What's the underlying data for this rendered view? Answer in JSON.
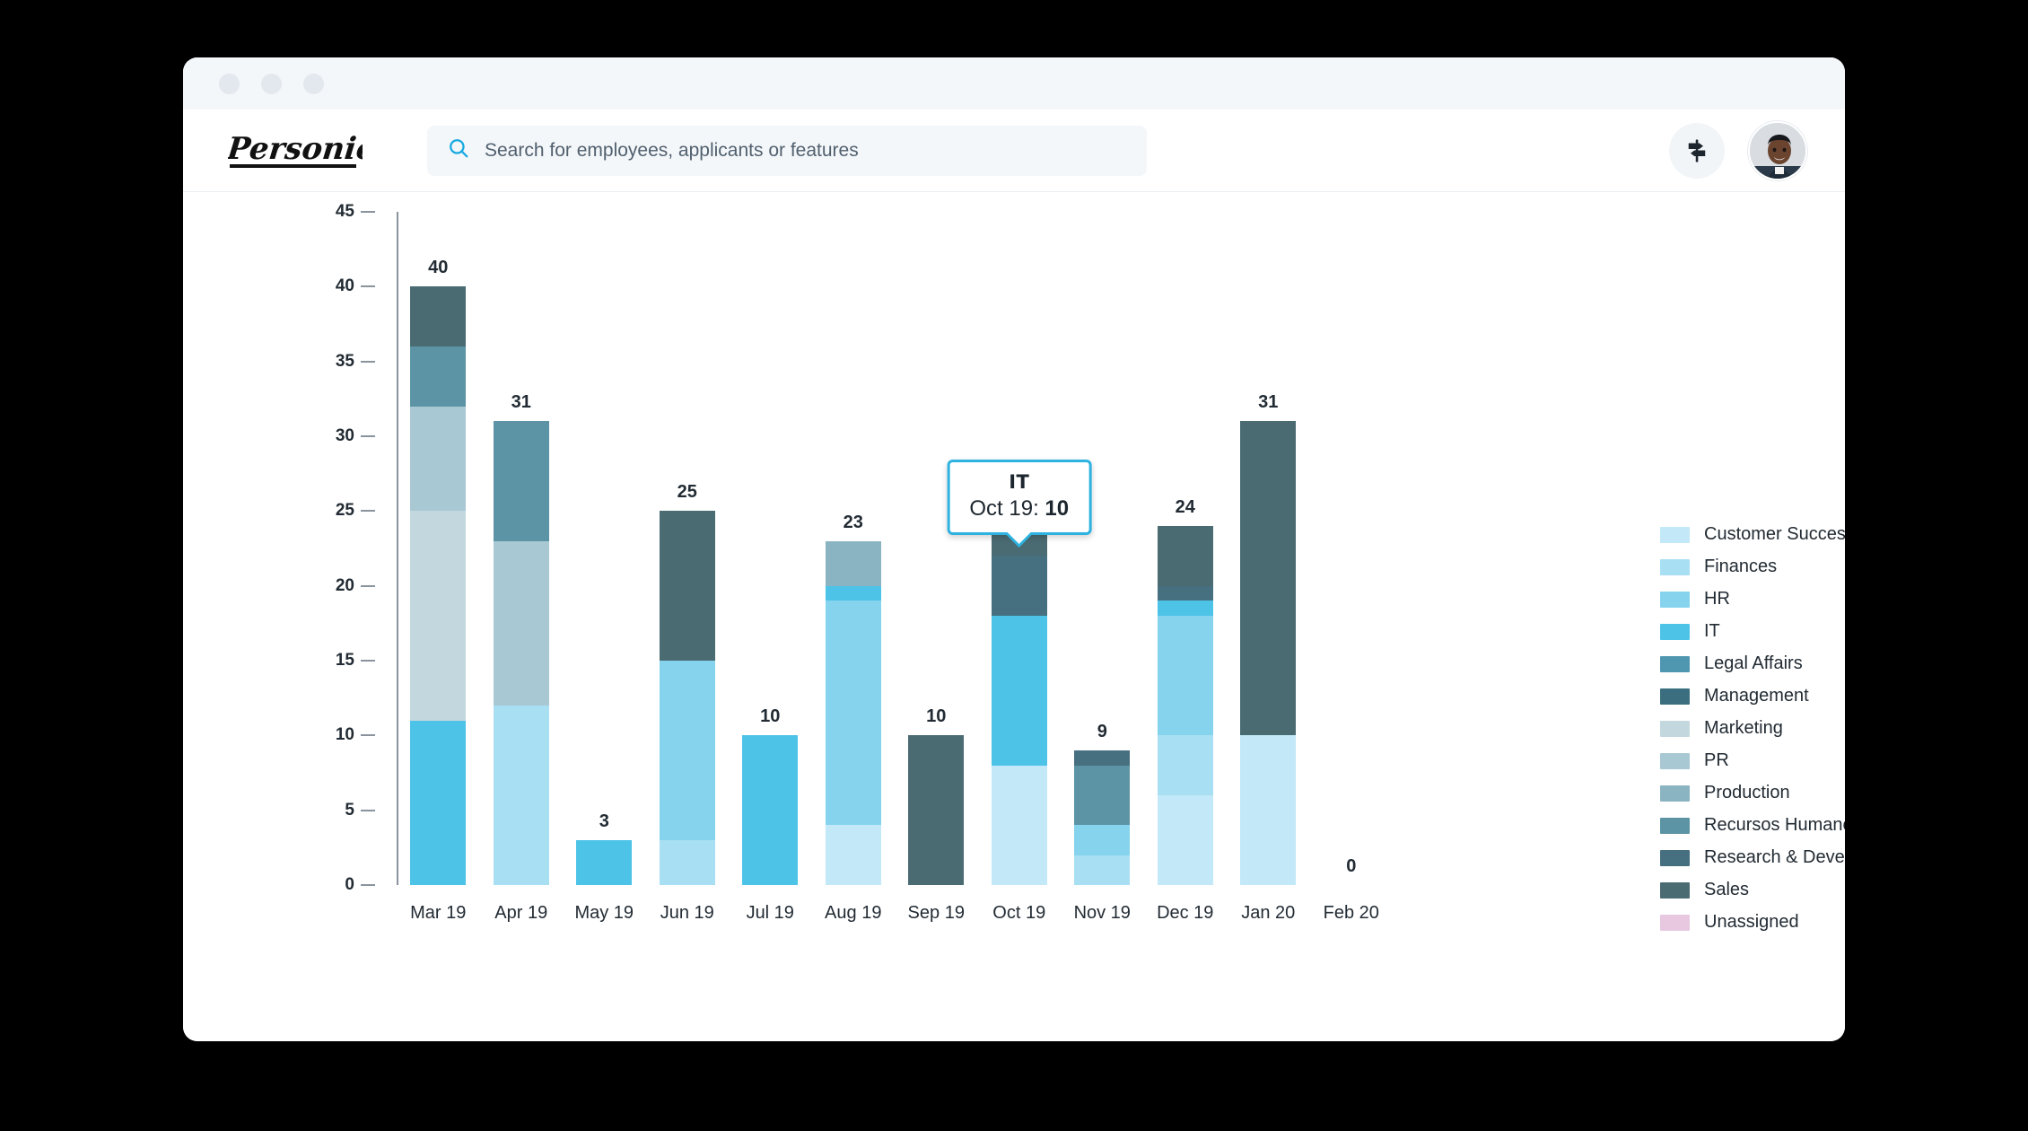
{
  "window": {
    "titlebar_dots": [
      "dot-1",
      "dot-2",
      "dot-3"
    ]
  },
  "header": {
    "logo_text": "Personio",
    "search": {
      "placeholder": "Search for employees, applicants or features",
      "value": "",
      "icon": "search-icon"
    },
    "signpost_icon": "signpost-icon",
    "avatar_icon": "user-avatar"
  },
  "tooltip": {
    "title": "IT",
    "period": "Oct 19:",
    "value": "10"
  },
  "legend": {
    "items": [
      {
        "label": "Customer Success",
        "color": "#c3e9f8"
      },
      {
        "label": "Finances",
        "color": "#a8dff2"
      },
      {
        "label": "HR",
        "color": "#86d3ee"
      },
      {
        "label": "IT",
        "color": "#4dc3e8"
      },
      {
        "label": "Legal Affairs",
        "color": "#4f97b0"
      },
      {
        "label": "Management",
        "color": "#3b6f80"
      },
      {
        "label": "Marketing",
        "color": "#c3d8de"
      },
      {
        "label": "PR",
        "color": "#a8c8d3"
      },
      {
        "label": "Production",
        "color": "#8bb4c2"
      },
      {
        "label": "Recursos Humanos España",
        "color": "#5c94a6"
      },
      {
        "label": "Research & Development",
        "color": "#46707f"
      },
      {
        "label": "Sales",
        "color": "#4a6b72"
      },
      {
        "label": "Unassigned",
        "color": "#e8c8e0"
      }
    ]
  },
  "chart_data": {
    "type": "bar",
    "subtype": "stacked",
    "title": "",
    "xlabel": "",
    "ylabel": "",
    "ylim": [
      0,
      45
    ],
    "yticks": [
      0,
      5,
      10,
      15,
      20,
      25,
      30,
      35,
      40,
      45
    ],
    "grid": false,
    "legend_position": "right",
    "categories": [
      "Mar 19",
      "Apr 19",
      "May 19",
      "Jun 19",
      "Jul 19",
      "Aug 19",
      "Sep 19",
      "Oct 19",
      "Nov 19",
      "Dec 19",
      "Jan 20",
      "Feb 20"
    ],
    "totals": [
      40,
      31,
      3,
      25,
      10,
      23,
      10,
      24,
      9,
      24,
      31,
      0
    ],
    "series": [
      {
        "name": "Customer Success",
        "color": "#c3e9f8",
        "values": [
          0,
          0,
          0,
          0,
          0,
          4,
          0,
          8,
          0,
          6,
          10,
          0
        ]
      },
      {
        "name": "Finances",
        "color": "#a8dff2",
        "values": [
          0,
          12,
          0,
          3,
          0,
          0,
          0,
          0,
          2,
          4,
          0,
          0
        ]
      },
      {
        "name": "HR",
        "color": "#86d3ee",
        "values": [
          0,
          0,
          0,
          12,
          0,
          15,
          0,
          0,
          2,
          8,
          0,
          0
        ]
      },
      {
        "name": "IT",
        "color": "#4dc3e8",
        "values": [
          11,
          0,
          3,
          0,
          10,
          1,
          0,
          10,
          0,
          1,
          0,
          0
        ]
      },
      {
        "name": "Legal Affairs",
        "color": "#4f97b0",
        "values": [
          0,
          0,
          0,
          0,
          0,
          0,
          0,
          0,
          0,
          0,
          0,
          0
        ]
      },
      {
        "name": "Management",
        "color": "#3b6f80",
        "values": [
          0,
          0,
          0,
          0,
          0,
          0,
          0,
          0,
          0,
          0,
          0,
          0
        ]
      },
      {
        "name": "Marketing",
        "color": "#c3d8de",
        "values": [
          14,
          0,
          0,
          0,
          0,
          0,
          0,
          0,
          0,
          0,
          0,
          0
        ]
      },
      {
        "name": "PR",
        "color": "#a8c8d3",
        "values": [
          7,
          11,
          0,
          0,
          0,
          0,
          0,
          0,
          0,
          0,
          0,
          0
        ]
      },
      {
        "name": "Production",
        "color": "#8bb4c2",
        "values": [
          0,
          0,
          0,
          0,
          0,
          3,
          0,
          0,
          0,
          0,
          0,
          0
        ]
      },
      {
        "name": "Recursos Humanos España",
        "color": "#5c94a6",
        "values": [
          4,
          8,
          0,
          0,
          0,
          0,
          0,
          0,
          4,
          0,
          0,
          0
        ]
      },
      {
        "name": "Research & Development",
        "color": "#46707f",
        "values": [
          0,
          0,
          0,
          0,
          0,
          0,
          0,
          4,
          1,
          1,
          0,
          0
        ]
      },
      {
        "name": "Sales",
        "color": "#4a6b72",
        "values": [
          4,
          0,
          0,
          10,
          0,
          0,
          10,
          2,
          0,
          4,
          21,
          0
        ]
      },
      {
        "name": "Unassigned",
        "color": "#e8c8e0",
        "values": [
          0,
          0,
          0,
          0,
          0,
          0,
          0,
          0,
          0,
          0,
          0,
          0
        ]
      }
    ]
  }
}
